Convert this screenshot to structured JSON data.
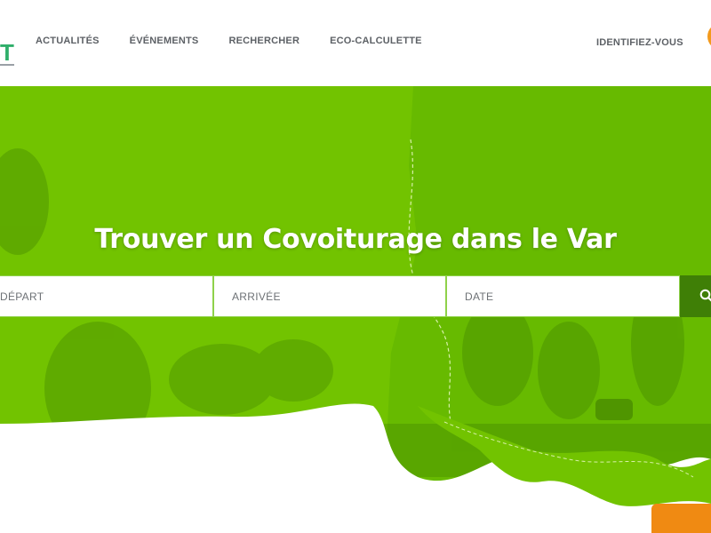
{
  "header": {
    "logo_text": "T",
    "nav": [
      {
        "label": "ACTUALITÉS"
      },
      {
        "label": "ÉVÉNEMENTS"
      },
      {
        "label": "RECHERCHER"
      },
      {
        "label": "ECO-CALCULETTE"
      }
    ],
    "login_label": "IDENTIFIEZ-VOUS",
    "user_icon": "user-circle-icon"
  },
  "hero": {
    "title": "Trouver un Covoiturage dans le Var",
    "search": {
      "depart_placeholder": "DÉPART",
      "arrivee_placeholder": "ARRIVÉE",
      "date_placeholder": "DATE",
      "button_icon": "search-icon"
    }
  },
  "colors": {
    "brand_green": "#72c300",
    "dark_green": "#3f7f06",
    "accent_orange": "#f08a12",
    "logo_green": "#2fae6a"
  }
}
